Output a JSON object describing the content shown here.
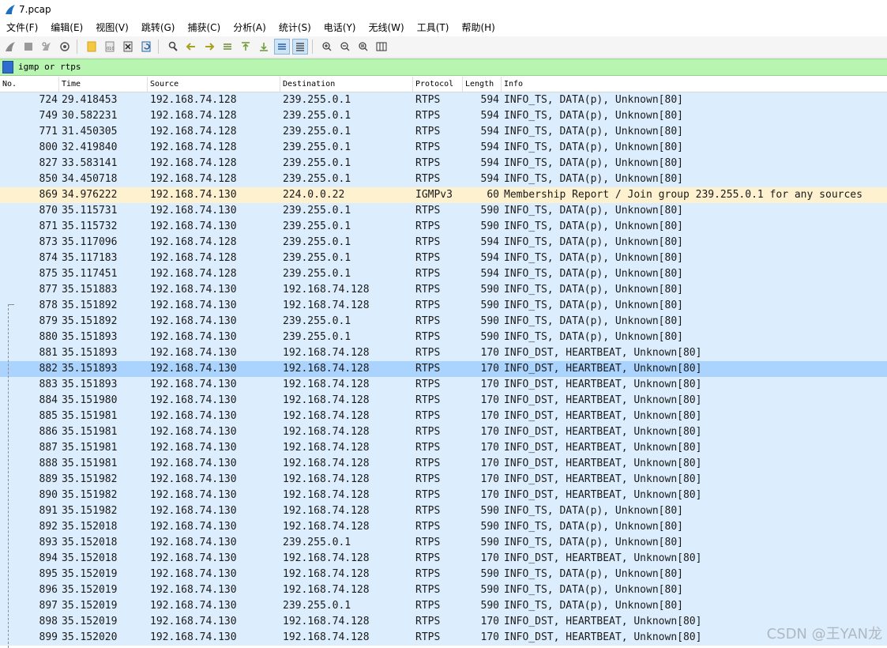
{
  "window": {
    "title": "7.pcap"
  },
  "menu": [
    "文件(F)",
    "编辑(E)",
    "视图(V)",
    "跳转(G)",
    "捕获(C)",
    "分析(A)",
    "统计(S)",
    "电话(Y)",
    "无线(W)",
    "工具(T)",
    "帮助(H)"
  ],
  "toolbar_icons": [
    "shark-fin-start-icon",
    "stop-square-icon",
    "restart-fin-icon",
    "capture-options-gear-icon",
    "open-folder-icon",
    "file-save-icon",
    "close-file-icon",
    "reload-icon",
    "find-packet-icon",
    "go-back-arrow-icon",
    "go-forward-arrow-icon",
    "go-to-packet-icon",
    "go-first-icon",
    "go-last-icon",
    "auto-scroll-icon",
    "colorize-icon",
    "zoom-in-icon",
    "zoom-out-icon",
    "zoom-normal-icon",
    "resize-columns-icon"
  ],
  "filter": {
    "value": "igmp or rtps"
  },
  "columns": {
    "no": "No.",
    "time": "Time",
    "source": "Source",
    "destination": "Destination",
    "protocol": "Protocol",
    "length": "Length",
    "info": "Info"
  },
  "colors": {
    "rtps_row": "#dcedfd",
    "igmp_row": "#fef1d0",
    "selected_row": "#aad4fd",
    "filter_bg": "#b8f5b0"
  },
  "packets": [
    {
      "no": "724",
      "time": "29.418453",
      "src": "192.168.74.128",
      "dst": "239.255.0.1",
      "proto": "RTPS",
      "len": "594",
      "info": "INFO_TS, DATA(p), Unknown[80]"
    },
    {
      "no": "749",
      "time": "30.582231",
      "src": "192.168.74.128",
      "dst": "239.255.0.1",
      "proto": "RTPS",
      "len": "594",
      "info": "INFO_TS, DATA(p), Unknown[80]"
    },
    {
      "no": "771",
      "time": "31.450305",
      "src": "192.168.74.128",
      "dst": "239.255.0.1",
      "proto": "RTPS",
      "len": "594",
      "info": "INFO_TS, DATA(p), Unknown[80]"
    },
    {
      "no": "800",
      "time": "32.419840",
      "src": "192.168.74.128",
      "dst": "239.255.0.1",
      "proto": "RTPS",
      "len": "594",
      "info": "INFO_TS, DATA(p), Unknown[80]"
    },
    {
      "no": "827",
      "time": "33.583141",
      "src": "192.168.74.128",
      "dst": "239.255.0.1",
      "proto": "RTPS",
      "len": "594",
      "info": "INFO_TS, DATA(p), Unknown[80]"
    },
    {
      "no": "850",
      "time": "34.450718",
      "src": "192.168.74.128",
      "dst": "239.255.0.1",
      "proto": "RTPS",
      "len": "594",
      "info": "INFO_TS, DATA(p), Unknown[80]"
    },
    {
      "no": "869",
      "time": "34.976222",
      "src": "192.168.74.130",
      "dst": "224.0.0.22",
      "proto": "IGMPv3",
      "len": "60",
      "info": "Membership Report / Join group 239.255.0.1 for any sources"
    },
    {
      "no": "870",
      "time": "35.115731",
      "src": "192.168.74.130",
      "dst": "239.255.0.1",
      "proto": "RTPS",
      "len": "590",
      "info": "INFO_TS, DATA(p), Unknown[80]"
    },
    {
      "no": "871",
      "time": "35.115732",
      "src": "192.168.74.130",
      "dst": "239.255.0.1",
      "proto": "RTPS",
      "len": "590",
      "info": "INFO_TS, DATA(p), Unknown[80]"
    },
    {
      "no": "873",
      "time": "35.117096",
      "src": "192.168.74.128",
      "dst": "239.255.0.1",
      "proto": "RTPS",
      "len": "594",
      "info": "INFO_TS, DATA(p), Unknown[80]"
    },
    {
      "no": "874",
      "time": "35.117183",
      "src": "192.168.74.128",
      "dst": "239.255.0.1",
      "proto": "RTPS",
      "len": "594",
      "info": "INFO_TS, DATA(p), Unknown[80]"
    },
    {
      "no": "875",
      "time": "35.117451",
      "src": "192.168.74.128",
      "dst": "239.255.0.1",
      "proto": "RTPS",
      "len": "594",
      "info": "INFO_TS, DATA(p), Unknown[80]"
    },
    {
      "no": "877",
      "time": "35.151883",
      "src": "192.168.74.130",
      "dst": "192.168.74.128",
      "proto": "RTPS",
      "len": "590",
      "info": "INFO_TS, DATA(p), Unknown[80]"
    },
    {
      "no": "878",
      "time": "35.151892",
      "src": "192.168.74.130",
      "dst": "192.168.74.128",
      "proto": "RTPS",
      "len": "590",
      "info": "INFO_TS, DATA(p), Unknown[80]"
    },
    {
      "no": "879",
      "time": "35.151892",
      "src": "192.168.74.130",
      "dst": "239.255.0.1",
      "proto": "RTPS",
      "len": "590",
      "info": "INFO_TS, DATA(p), Unknown[80]"
    },
    {
      "no": "880",
      "time": "35.151893",
      "src": "192.168.74.130",
      "dst": "239.255.0.1",
      "proto": "RTPS",
      "len": "590",
      "info": "INFO_TS, DATA(p), Unknown[80]"
    },
    {
      "no": "881",
      "time": "35.151893",
      "src": "192.168.74.130",
      "dst": "192.168.74.128",
      "proto": "RTPS",
      "len": "170",
      "info": "INFO_DST, HEARTBEAT, Unknown[80]"
    },
    {
      "no": "882",
      "time": "35.151893",
      "src": "192.168.74.130",
      "dst": "192.168.74.128",
      "proto": "RTPS",
      "len": "170",
      "info": "INFO_DST, HEARTBEAT, Unknown[80]",
      "selected": true
    },
    {
      "no": "883",
      "time": "35.151893",
      "src": "192.168.74.130",
      "dst": "192.168.74.128",
      "proto": "RTPS",
      "len": "170",
      "info": "INFO_DST, HEARTBEAT, Unknown[80]"
    },
    {
      "no": "884",
      "time": "35.151980",
      "src": "192.168.74.130",
      "dst": "192.168.74.128",
      "proto": "RTPS",
      "len": "170",
      "info": "INFO_DST, HEARTBEAT, Unknown[80]"
    },
    {
      "no": "885",
      "time": "35.151981",
      "src": "192.168.74.130",
      "dst": "192.168.74.128",
      "proto": "RTPS",
      "len": "170",
      "info": "INFO_DST, HEARTBEAT, Unknown[80]"
    },
    {
      "no": "886",
      "time": "35.151981",
      "src": "192.168.74.130",
      "dst": "192.168.74.128",
      "proto": "RTPS",
      "len": "170",
      "info": "INFO_DST, HEARTBEAT, Unknown[80]"
    },
    {
      "no": "887",
      "time": "35.151981",
      "src": "192.168.74.130",
      "dst": "192.168.74.128",
      "proto": "RTPS",
      "len": "170",
      "info": "INFO_DST, HEARTBEAT, Unknown[80]"
    },
    {
      "no": "888",
      "time": "35.151981",
      "src": "192.168.74.130",
      "dst": "192.168.74.128",
      "proto": "RTPS",
      "len": "170",
      "info": "INFO_DST, HEARTBEAT, Unknown[80]"
    },
    {
      "no": "889",
      "time": "35.151982",
      "src": "192.168.74.130",
      "dst": "192.168.74.128",
      "proto": "RTPS",
      "len": "170",
      "info": "INFO_DST, HEARTBEAT, Unknown[80]"
    },
    {
      "no": "890",
      "time": "35.151982",
      "src": "192.168.74.130",
      "dst": "192.168.74.128",
      "proto": "RTPS",
      "len": "170",
      "info": "INFO_DST, HEARTBEAT, Unknown[80]"
    },
    {
      "no": "891",
      "time": "35.151982",
      "src": "192.168.74.130",
      "dst": "192.168.74.128",
      "proto": "RTPS",
      "len": "590",
      "info": "INFO_TS, DATA(p), Unknown[80]"
    },
    {
      "no": "892",
      "time": "35.152018",
      "src": "192.168.74.130",
      "dst": "192.168.74.128",
      "proto": "RTPS",
      "len": "590",
      "info": "INFO_TS, DATA(p), Unknown[80]"
    },
    {
      "no": "893",
      "time": "35.152018",
      "src": "192.168.74.130",
      "dst": "239.255.0.1",
      "proto": "RTPS",
      "len": "590",
      "info": "INFO_TS, DATA(p), Unknown[80]"
    },
    {
      "no": "894",
      "time": "35.152018",
      "src": "192.168.74.130",
      "dst": "192.168.74.128",
      "proto": "RTPS",
      "len": "170",
      "info": "INFO_DST, HEARTBEAT, Unknown[80]"
    },
    {
      "no": "895",
      "time": "35.152019",
      "src": "192.168.74.130",
      "dst": "192.168.74.128",
      "proto": "RTPS",
      "len": "590",
      "info": "INFO_TS, DATA(p), Unknown[80]"
    },
    {
      "no": "896",
      "time": "35.152019",
      "src": "192.168.74.130",
      "dst": "192.168.74.128",
      "proto": "RTPS",
      "len": "590",
      "info": "INFO_TS, DATA(p), Unknown[80]"
    },
    {
      "no": "897",
      "time": "35.152019",
      "src": "192.168.74.130",
      "dst": "239.255.0.1",
      "proto": "RTPS",
      "len": "590",
      "info": "INFO_TS, DATA(p), Unknown[80]"
    },
    {
      "no": "898",
      "time": "35.152019",
      "src": "192.168.74.130",
      "dst": "192.168.74.128",
      "proto": "RTPS",
      "len": "170",
      "info": "INFO_DST, HEARTBEAT, Unknown[80]"
    },
    {
      "no": "899",
      "time": "35.152020",
      "src": "192.168.74.130",
      "dst": "192.168.74.128",
      "proto": "RTPS",
      "len": "170",
      "info": "INFO_DST, HEARTBEAT, Unknown[80]"
    }
  ],
  "watermark": "CSDN @王YAN龙"
}
